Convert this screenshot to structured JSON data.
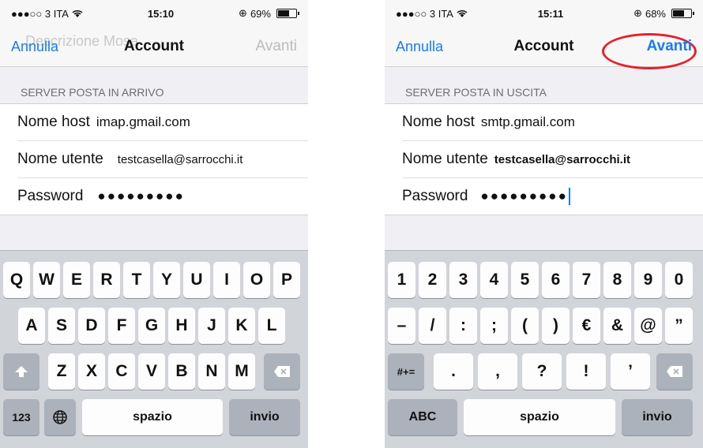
{
  "left": {
    "status": {
      "carrier": "●●●○○ 3 ITA",
      "wifi": "wifi-icon",
      "time": "15:10",
      "battery_pct": "69%",
      "battery_level": 0.69
    },
    "nav": {
      "ghost": "Descrizione Mosa",
      "cancel": "Annulla",
      "title": "Account",
      "next": "Avanti"
    },
    "section": "SERVER POSTA IN ARRIVO",
    "rows": [
      {
        "label": "Nome host",
        "value": "imap.gmail.com"
      },
      {
        "label": "Nome utente",
        "value": "testcasella@sarrocchi.it"
      },
      {
        "label": "Password",
        "value": "●●●●●●●●●"
      }
    ],
    "keyboard": {
      "row1": [
        "Q",
        "W",
        "E",
        "R",
        "T",
        "Y",
        "U",
        "I",
        "O",
        "P"
      ],
      "row2": [
        "A",
        "S",
        "D",
        "F",
        "G",
        "H",
        "J",
        "K",
        "L"
      ],
      "row3": [
        "Z",
        "X",
        "C",
        "V",
        "B",
        "N",
        "M"
      ],
      "numbers": "123",
      "space": "spazio",
      "return": "invio",
      "shift": "shift-icon",
      "globe": "globe-icon",
      "delete": "delete-icon"
    }
  },
  "right": {
    "status": {
      "carrier": "●●●○○ 3 ITA",
      "wifi": "wifi-icon",
      "time": "15:11",
      "battery_pct": "68%",
      "battery_level": 0.68
    },
    "nav": {
      "cancel": "Annulla",
      "title": "Account",
      "next": "Avanti"
    },
    "section": "SERVER POSTA IN USCITA",
    "rows": [
      {
        "label": "Nome host",
        "value": "smtp.gmail.com"
      },
      {
        "label": "Nome utente",
        "value": "testcasella@sarrocchi.it"
      },
      {
        "label": "Password",
        "value": "●●●●●●●●●"
      }
    ],
    "keyboard": {
      "row1": [
        "1",
        "2",
        "3",
        "4",
        "5",
        "6",
        "7",
        "8",
        "9",
        "0"
      ],
      "row2": [
        "–",
        "/",
        ":",
        ";",
        "(",
        ")",
        "€",
        "&",
        "@",
        "”"
      ],
      "row3": [
        ".",
        ",",
        "?",
        "!",
        "’"
      ],
      "symbols": "#+=",
      "abc": "ABC",
      "space": "spazio",
      "return": "invio",
      "delete": "delete-icon"
    }
  },
  "colors": {
    "ios_blue": "#1a7bf0",
    "annotation_red": "#e5212b",
    "keyboard_bg": "#d1d4d9"
  }
}
